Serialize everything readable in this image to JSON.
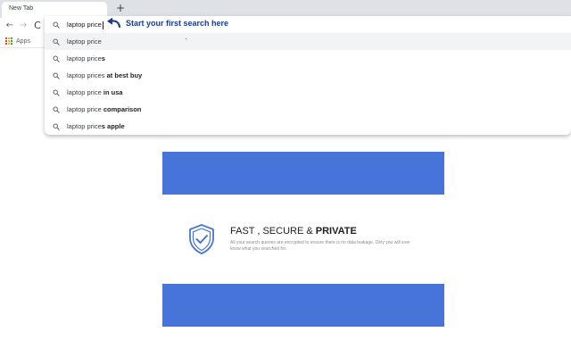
{
  "browser": {
    "tab_title": "New Tab",
    "new_tab_symbol": "+",
    "nav": {
      "back": "←",
      "forward": "→",
      "reload": "C"
    },
    "bookmarks": {
      "apps_label": "Apps"
    }
  },
  "omnibox": {
    "query": "laptop price",
    "hint": "Start your first search here",
    "suggestions": [
      {
        "base": "laptop price",
        "bold": ""
      },
      {
        "base": "laptop price",
        "bold": "s"
      },
      {
        "base": "laptop prices",
        "bold": " at best buy"
      },
      {
        "base": "laptop price",
        "bold": " in usa"
      },
      {
        "base": "laptop price",
        "bold": " comparison"
      },
      {
        "base": "laptop price",
        "bold": "s apple"
      }
    ]
  },
  "feature": {
    "title_light": "FAST , SECURE & ",
    "title_bold": "PRIVATE",
    "description": "All your search queries are encrypted to ensure there is no data leakage. Only you will ever know what you searched for."
  },
  "colors": {
    "banner": "#4674d9",
    "hint_text": "#1a3c8f",
    "shield": "#4674d9"
  },
  "icons": {
    "search": "search-icon",
    "hint_arrow": "arrow-left-icon",
    "shield": "shield-check-icon"
  }
}
